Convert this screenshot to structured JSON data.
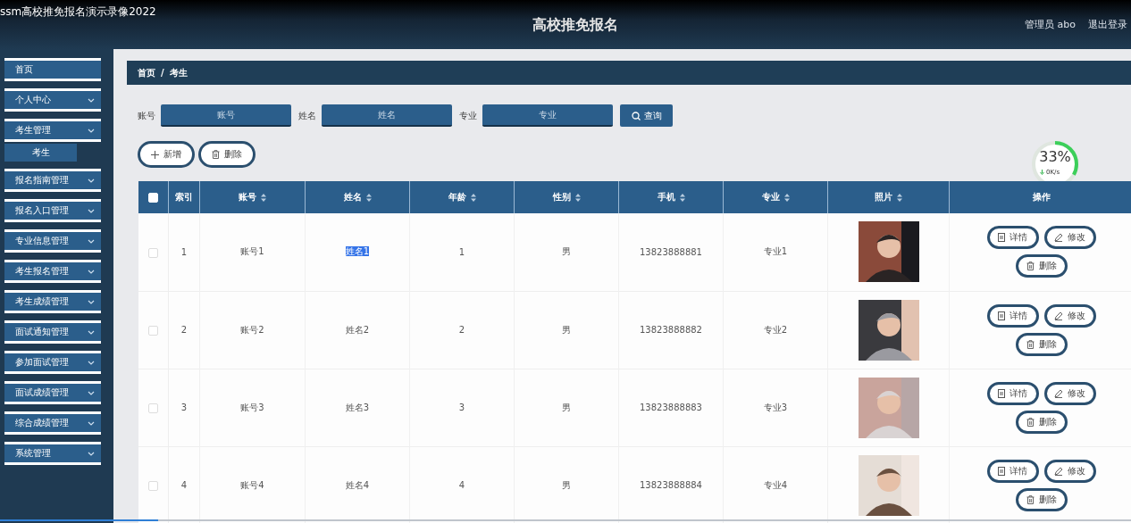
{
  "window": {
    "title": "ssm高校推免报名演示录像2022"
  },
  "header": {
    "title": "高校推免报名",
    "user": "管理员 abo",
    "logout": "退出登录"
  },
  "sidebar": {
    "items": [
      {
        "label": "首页",
        "kind": "link"
      },
      {
        "label": "个人中心",
        "kind": "menu"
      },
      {
        "label": "考生管理",
        "kind": "menu",
        "children": [
          {
            "label": "考生",
            "selected": true
          }
        ]
      },
      {
        "label": "报名指南管理",
        "kind": "menu"
      },
      {
        "label": "报名入口管理",
        "kind": "menu"
      },
      {
        "label": "专业信息管理",
        "kind": "menu"
      },
      {
        "label": "考生报名管理",
        "kind": "menu"
      },
      {
        "label": "考生成绩管理",
        "kind": "menu"
      },
      {
        "label": "面试通知管理",
        "kind": "menu"
      },
      {
        "label": "参加面试管理",
        "kind": "menu"
      },
      {
        "label": "面试成绩管理",
        "kind": "menu"
      },
      {
        "label": "综合成绩管理",
        "kind": "menu"
      },
      {
        "label": "系统管理",
        "kind": "menu"
      }
    ]
  },
  "breadcrumb": [
    "首页",
    "/",
    "考生"
  ],
  "search": {
    "fields": [
      {
        "label": "账号",
        "placeholder": "账号"
      },
      {
        "label": "姓名",
        "placeholder": "姓名"
      },
      {
        "label": "专业",
        "placeholder": "专业"
      }
    ],
    "button": "查询"
  },
  "actions": [
    {
      "kind": "add",
      "label": "新增"
    },
    {
      "kind": "delete",
      "label": "删除"
    }
  ],
  "speed_meter": {
    "percent": "33",
    "unit": "%",
    "speed": "0K/s"
  },
  "table": {
    "select_all_checked": false,
    "columns": [
      {
        "label": "索引",
        "sortable": false
      },
      {
        "label": "账号",
        "sortable": true
      },
      {
        "label": "姓名",
        "sortable": true
      },
      {
        "label": "年龄",
        "sortable": true
      },
      {
        "label": "性别",
        "sortable": true
      },
      {
        "label": "手机",
        "sortable": true
      },
      {
        "label": "专业",
        "sortable": true
      },
      {
        "label": "照片",
        "sortable": true
      },
      {
        "label": "操作",
        "sortable": false
      }
    ],
    "rows": [
      {
        "checked": false,
        "cells": [
          "1",
          "账号1",
          "姓名1",
          "1",
          "男",
          "13823888881",
          "专业1"
        ],
        "name_highlighted": true,
        "photo": {
          "kind": "picture"
        },
        "actions": [
          {
            "kind": "detail",
            "label": "详情"
          },
          {
            "kind": "edit",
            "label": "修改"
          },
          {
            "kind": "delete",
            "label": "删除"
          }
        ]
      },
      {
        "checked": false,
        "cells": [
          "2",
          "账号2",
          "姓名2",
          "2",
          "男",
          "13823888882",
          "专业2"
        ],
        "name_highlighted": false,
        "photo": {
          "kind": "picture"
        },
        "actions": [
          {
            "kind": "detail",
            "label": "详情"
          },
          {
            "kind": "edit",
            "label": "修改"
          },
          {
            "kind": "delete",
            "label": "删除"
          }
        ]
      },
      {
        "checked": false,
        "cells": [
          "3",
          "账号3",
          "姓名3",
          "3",
          "男",
          "13823888883",
          "专业3"
        ],
        "name_highlighted": false,
        "photo": {
          "kind": "picture"
        },
        "actions": [
          {
            "kind": "detail",
            "label": "详情"
          },
          {
            "kind": "edit",
            "label": "修改"
          },
          {
            "kind": "delete",
            "label": "删除"
          }
        ]
      },
      {
        "checked": false,
        "cells": [
          "4",
          "账号4",
          "姓名4",
          "4",
          "男",
          "13823888884",
          "专业4"
        ],
        "name_highlighted": false,
        "photo": {
          "kind": "picture"
        },
        "actions": [
          {
            "kind": "detail",
            "label": "详情"
          },
          {
            "kind": "edit",
            "label": "修改"
          },
          {
            "kind": "delete",
            "label": "删除"
          }
        ]
      }
    ]
  },
  "video_progress": {
    "level": 0.14
  }
}
